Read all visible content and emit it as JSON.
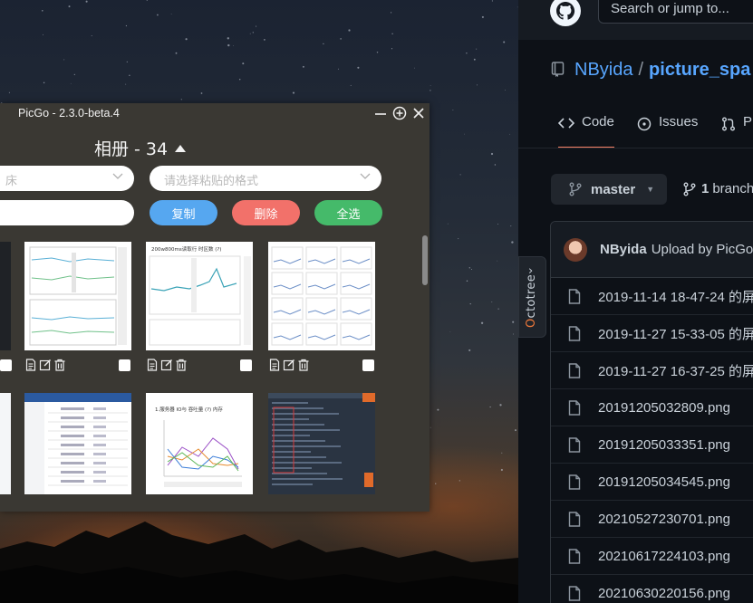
{
  "github": {
    "search_placeholder": "Search or jump to...",
    "repo_owner": "NByida",
    "repo_separator": "/",
    "repo_name": "picture_spa",
    "tabs": [
      {
        "label": "Code",
        "icon": "code-icon"
      },
      {
        "label": "Issues",
        "icon": "issue-icon"
      },
      {
        "label": "P",
        "icon": "pull-request-icon"
      }
    ],
    "branch_button_label": "master",
    "branch_count": "1",
    "branch_count_label": "branch",
    "latest_commit": {
      "author": "NByida",
      "message": "Upload by PicGo"
    },
    "files": [
      "2019-11-14 18-47-24 的屏",
      "2019-11-27 15-33-05 的屏",
      "2019-11-27 16-37-25 的屏",
      "20191205032809.png",
      "20191205033351.png",
      "20191205034545.png",
      "20210527230701.png",
      "20210617224103.png",
      "20210630220156.png"
    ]
  },
  "octotree": {
    "label_rest": "ctotree",
    "label_o": "O"
  },
  "picgo": {
    "window_title": "PicGo - 2.3.0-beta.4",
    "album_title": "相册 - 34",
    "left_select_text": "床",
    "format_select_placeholder": "请选择粘贴的格式",
    "buttons": {
      "copy": "复制",
      "delete": "删除",
      "select_all": "全选"
    },
    "colors": {
      "copy": "#56a7f0",
      "delete": "#f2716a",
      "select_all": "#45ba6a",
      "window_bg": "#3a3833"
    },
    "thumbnails": [
      {
        "kind": "dashboard-line-chart"
      },
      {
        "kind": "monitor-chart",
        "caption": "200w800ms读取行 时区数 (?)"
      },
      {
        "kind": "grafana-grid"
      },
      {
        "kind": "admin-table"
      },
      {
        "kind": "multi-line-chart",
        "caption": "1.服务器 IO与 吞吐量 (?) 内存"
      },
      {
        "kind": "dark-log-view"
      }
    ]
  }
}
